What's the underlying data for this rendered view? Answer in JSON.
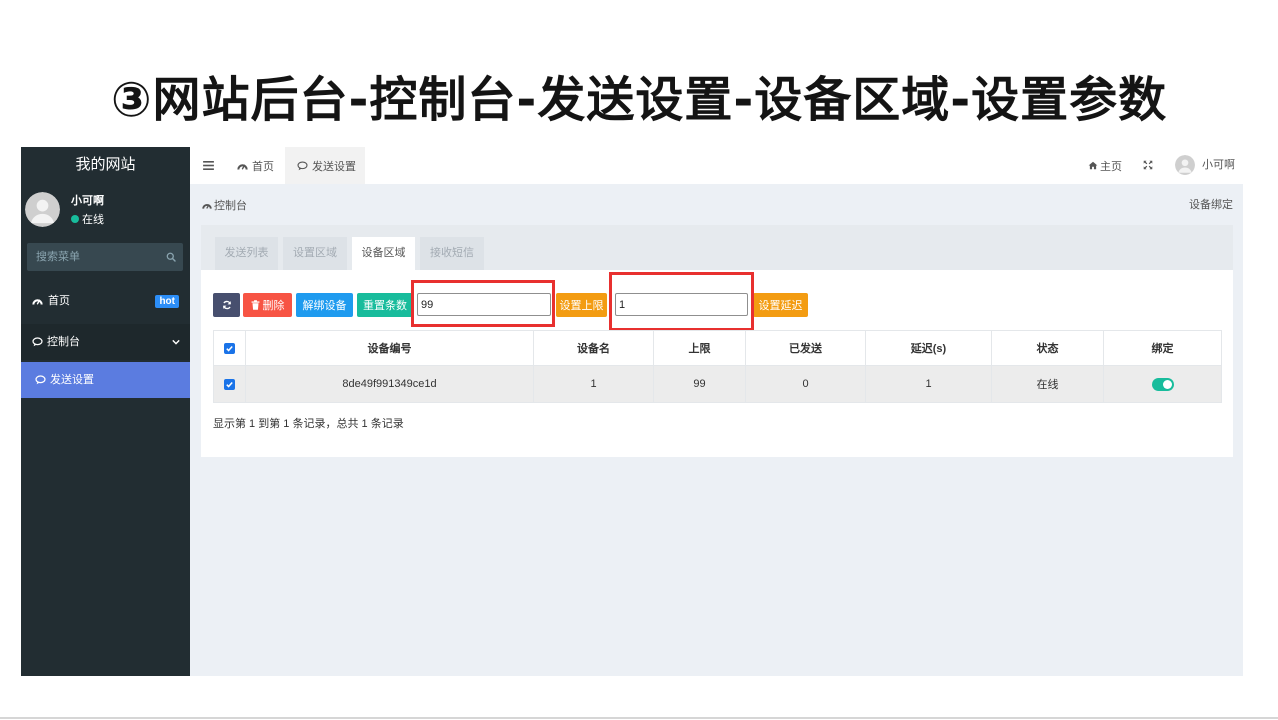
{
  "slide": {
    "title": "③网站后台-控制台-发送设置-设备区域-设置参数"
  },
  "sidebar": {
    "logo": "我的网站",
    "user": {
      "name": "小可啊",
      "status": "在线"
    },
    "search": {
      "placeholder": "搜索菜单",
      "icon": "search-icon"
    },
    "menu": [
      {
        "label": "首页",
        "icon": "dashboard-icon",
        "badge": "hot"
      },
      {
        "label": "控制台",
        "icon": "comment-icon",
        "expanded": true,
        "children": [
          {
            "label": "发送设置",
            "icon": "comment-icon",
            "active": true
          }
        ]
      }
    ]
  },
  "navbar": {
    "menu_icon": "hamburger-icon",
    "tabs": [
      {
        "label": "首页",
        "icon": "dashboard-icon",
        "active": false
      },
      {
        "label": "发送设置",
        "icon": "comment-icon",
        "active": true
      }
    ],
    "home_label": "主页",
    "home_icon": "home-icon",
    "fullscreen_icon": "fullscreen-icon",
    "user_name": "小可啊"
  },
  "breadcrumb": {
    "label": "控制台",
    "icon": "dashboard-icon",
    "right_label": "设备绑定"
  },
  "panel": {
    "tabs": [
      {
        "label": "发送列表",
        "active": false
      },
      {
        "label": "设置区域",
        "active": false
      },
      {
        "label": "设备区域",
        "active": true
      },
      {
        "label": "接收短信",
        "active": false
      }
    ],
    "toolbar": {
      "refresh_icon": "refresh-icon",
      "delete_icon": "trash-icon",
      "delete_label": "删除",
      "unbind_label": "解绑设备",
      "reset_label": "重置条数",
      "limit_value": "99",
      "set_limit_label": "设置上限",
      "delay_value": "1",
      "set_delay_label": "设置延迟"
    },
    "table": {
      "select_all_checked": true,
      "columns": [
        "设备编号",
        "设备名",
        "上限",
        "已发送",
        "延迟(s)",
        "状态",
        "绑定"
      ],
      "rows": [
        {
          "checked": true,
          "device_id": "8de49f991349ce1d",
          "device_name": "1",
          "limit": "99",
          "sent": "0",
          "delay": "1",
          "status": "在线",
          "bound": true
        }
      ]
    },
    "footer": "显示第 1 到第 1 条记录，总共 1 条记录"
  },
  "colors": {
    "sidebar_bg": "#222d32",
    "sidebar_open_item": "#1e282c",
    "active_submenu": "#5b7ce0",
    "badge": "#2c8ef8",
    "online_dot": "#18bc9c",
    "btn_refresh": "#474f6e",
    "btn_delete": "#f75444",
    "btn_unbind": "#1f9bef",
    "btn_reset": "#18bc9c",
    "btn_warning": "#f39c12",
    "toggle_on": "#18bc9c",
    "checkbox": "#1a73e8",
    "highlight_box": "#e8302f"
  }
}
